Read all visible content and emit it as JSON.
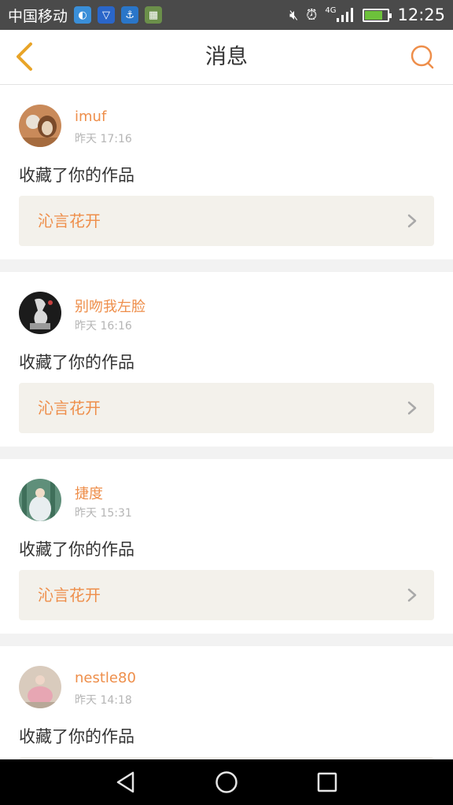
{
  "status_bar": {
    "carrier": "中国移动",
    "network": "4G",
    "time": "12:25",
    "icons": [
      "app-icon-1",
      "shield-icon",
      "download-icon",
      "gallery-icon",
      "mute-icon",
      "alarm-icon",
      "signal-icon",
      "battery-icon"
    ]
  },
  "header": {
    "title": "消息",
    "back_icon": "chevron-left-icon",
    "search_icon": "search-icon",
    "accent": "#ee8e4a",
    "back_color": "#e8a428"
  },
  "messages": [
    {
      "username": "imuf",
      "time": "昨天 17:16",
      "action": "收藏了你的作品",
      "work_title": "沁言花开"
    },
    {
      "username": "别吻我左脸",
      "time": "昨天 16:16",
      "action": "收藏了你的作品",
      "work_title": "沁言花开"
    },
    {
      "username": "捷度",
      "time": "昨天 15:31",
      "action": "收藏了你的作品",
      "work_title": "沁言花开"
    },
    {
      "username": "nestle80",
      "time": "昨天 14:18",
      "action": "收藏了你的作品",
      "work_title": ""
    }
  ],
  "nav_bar": {
    "icons": [
      "back-triangle-icon",
      "home-circle-icon",
      "recents-square-icon"
    ]
  }
}
